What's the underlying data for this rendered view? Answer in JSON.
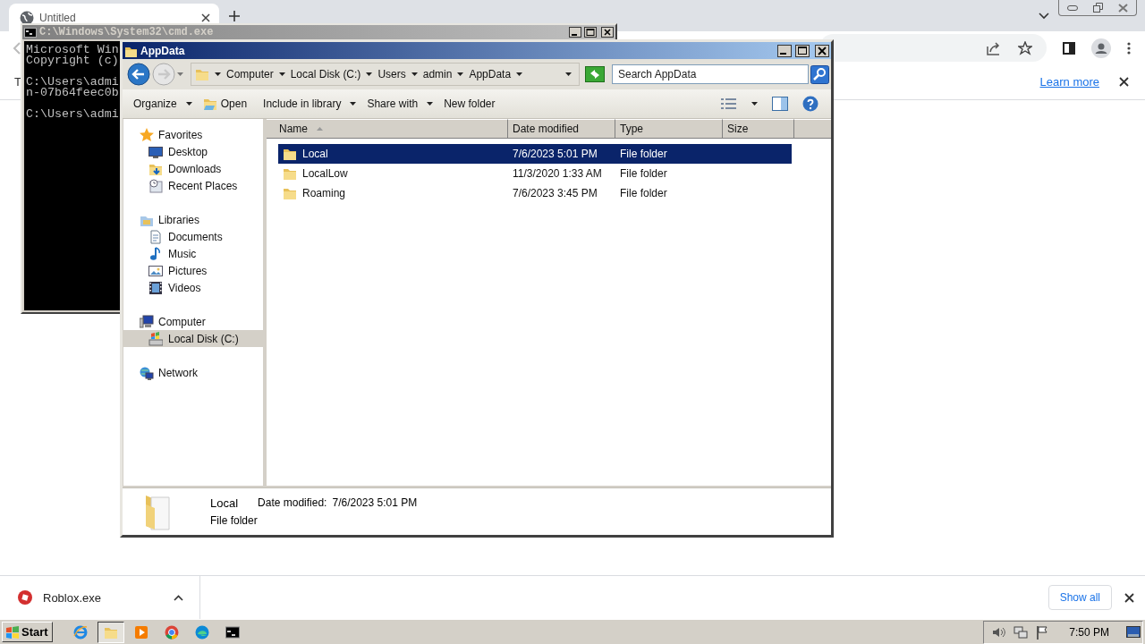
{
  "browser": {
    "tab": {
      "title": "Untitled",
      "selected": true
    },
    "infobar": {
      "text": "T",
      "link": "Learn more"
    },
    "download_bar": {
      "items": [
        {
          "name": "Roblox.exe"
        }
      ],
      "show_all": "Show all"
    }
  },
  "cmd_window": {
    "title": "C:\\Windows\\System32\\cmd.exe",
    "active": false,
    "blocks": [
      [
        "Microsoft Win",
        "Copyright (c)"
      ],
      [
        "C:\\Users\\admi",
        "n-07b64feec0b"
      ],
      [
        "C:\\Users\\admi"
      ]
    ]
  },
  "explorer": {
    "title": "AppData",
    "active": true,
    "breadcrumb": [
      "Computer",
      "Local Disk (C:)",
      "Users",
      "admin",
      "AppData"
    ],
    "search": {
      "placeholder": "Search AppData"
    },
    "toolbar": [
      {
        "label": "Organize",
        "dropdown": true
      },
      {
        "label": "Open",
        "dropdown": false
      },
      {
        "label": "Include in library",
        "dropdown": true
      },
      {
        "label": "Share with",
        "dropdown": true
      },
      {
        "label": "New folder",
        "dropdown": false
      }
    ],
    "nav": [
      {
        "label": "Favorites",
        "selected": false,
        "children": [
          {
            "label": "Desktop",
            "selected": false
          },
          {
            "label": "Downloads",
            "selected": false
          },
          {
            "label": "Recent Places",
            "selected": false
          }
        ]
      },
      {
        "label": "Libraries",
        "selected": false,
        "children": [
          {
            "label": "Documents",
            "selected": false
          },
          {
            "label": "Music",
            "selected": false
          },
          {
            "label": "Pictures",
            "selected": false
          },
          {
            "label": "Videos",
            "selected": false
          }
        ]
      },
      {
        "label": "Computer",
        "selected": false,
        "children": [
          {
            "label": "Local Disk (C:)",
            "selected": true
          }
        ]
      },
      {
        "label": "Network",
        "selected": false
      }
    ],
    "columns": [
      {
        "label": "Name",
        "sorted": true
      },
      {
        "label": "Date modified",
        "sorted": false
      },
      {
        "label": "Type",
        "sorted": false
      },
      {
        "label": "Size",
        "sorted": false
      }
    ],
    "rows": [
      {
        "name": "Local",
        "date": "7/6/2023 5:01 PM",
        "type": "File folder",
        "selected": true
      },
      {
        "name": "LocalLow",
        "date": "11/3/2020 1:33 AM",
        "type": "File folder",
        "selected": false
      },
      {
        "name": "Roaming",
        "date": "7/6/2023 3:45 PM",
        "type": "File folder",
        "selected": false
      }
    ],
    "details": {
      "name": "Local",
      "fields": [
        {
          "label": "Date modified:",
          "value": "7/6/2023 5:01 PM"
        }
      ],
      "type": "File folder"
    }
  },
  "taskbar": {
    "start": "Start",
    "apps": [
      {
        "pressed": false
      },
      {
        "pressed": true
      },
      {
        "pressed": false
      },
      {
        "pressed": false
      },
      {
        "pressed": false
      },
      {
        "pressed": false
      }
    ],
    "clock": "7:50 PM"
  }
}
